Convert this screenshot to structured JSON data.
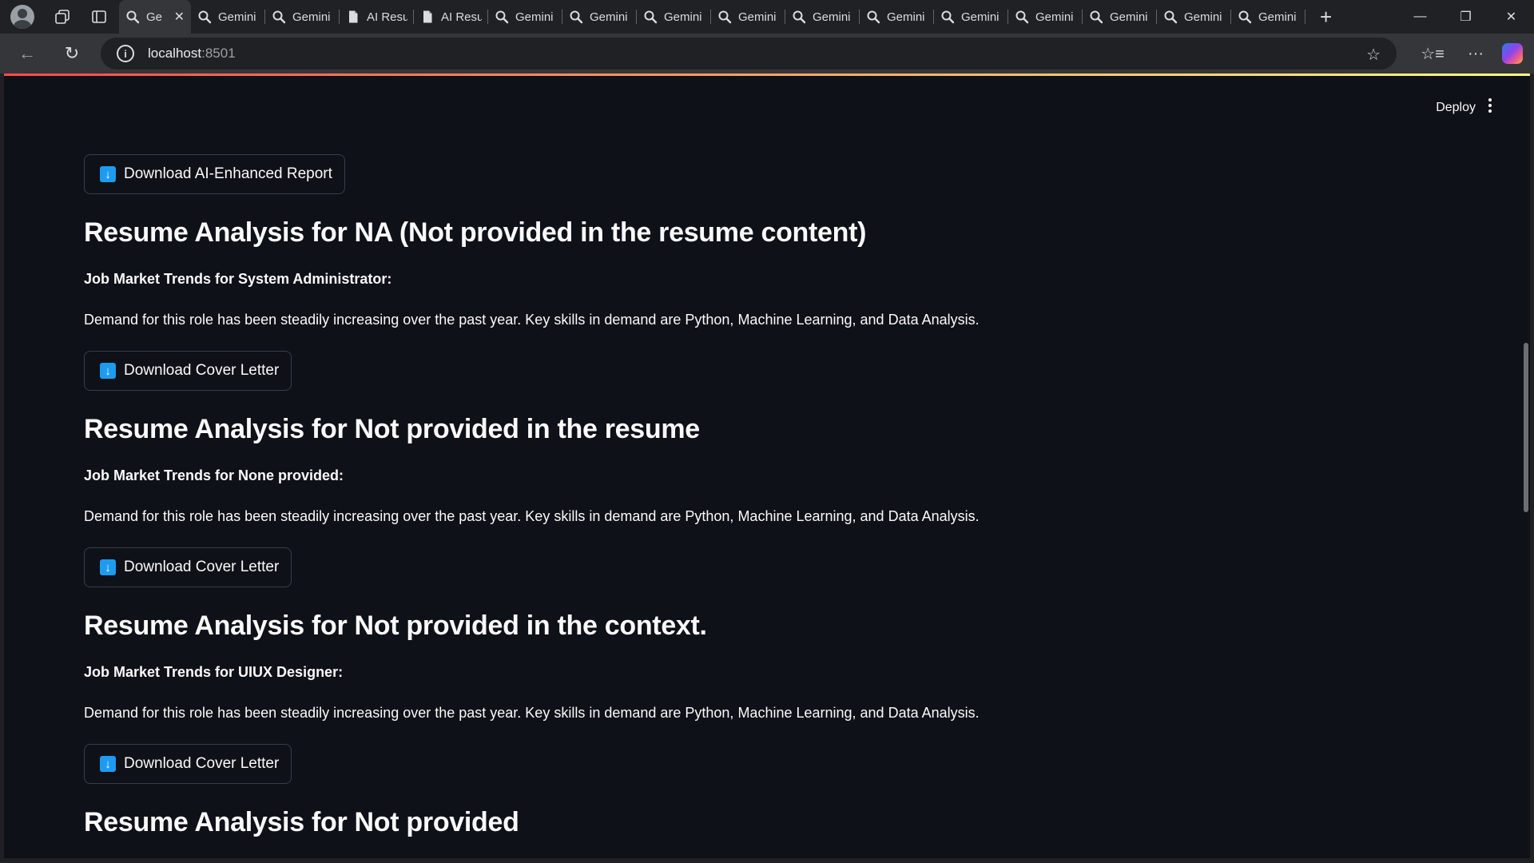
{
  "browser": {
    "tabs": [
      {
        "title": "Ge",
        "icon": "search-icon",
        "active": true
      },
      {
        "title": "Gemini",
        "icon": "search-icon"
      },
      {
        "title": "Gemini",
        "icon": "search-icon"
      },
      {
        "title": "AI Resu",
        "icon": "document-icon"
      },
      {
        "title": "AI Resu",
        "icon": "document-icon"
      },
      {
        "title": "Gemini",
        "icon": "search-icon"
      },
      {
        "title": "Gemini",
        "icon": "search-icon"
      },
      {
        "title": "Gemini",
        "icon": "search-icon"
      },
      {
        "title": "Gemini",
        "icon": "search-icon"
      },
      {
        "title": "Gemini",
        "icon": "search-icon"
      },
      {
        "title": "Gemini",
        "icon": "search-icon"
      },
      {
        "title": "Gemini",
        "icon": "search-icon"
      },
      {
        "title": "Gemini",
        "icon": "search-icon"
      },
      {
        "title": "Gemini",
        "icon": "search-icon"
      },
      {
        "title": "Gemini",
        "icon": "search-icon"
      },
      {
        "title": "Gemini",
        "icon": "search-icon"
      }
    ],
    "address": {
      "host": "localhost",
      "port": ":8501"
    }
  },
  "app": {
    "header": {
      "deploy_label": "Deploy"
    },
    "download_report_label": "Download AI-Enhanced Report",
    "sections": [
      {
        "heading": "Resume Analysis for NA (Not provided in the resume content)",
        "trends_label": "Job Market Trends for System Administrator:",
        "trends_text": "Demand for this role has been steadily increasing over the past year. Key skills in demand are Python, Machine Learning, and Data Analysis.",
        "button_label": "Download Cover Letter"
      },
      {
        "heading": "Resume Analysis for Not provided in the resume",
        "trends_label": "Job Market Trends for None provided:",
        "trends_text": "Demand for this role has been steadily increasing over the past year. Key skills in demand are Python, Machine Learning, and Data Analysis.",
        "button_label": "Download Cover Letter"
      },
      {
        "heading": "Resume Analysis for Not provided in the context.",
        "trends_label": "Job Market Trends for UIUX Designer:",
        "trends_text": "Demand for this role has been steadily increasing over the past year. Key skills in demand are Python, Machine Learning, and Data Analysis.",
        "button_label": "Download Cover Letter"
      },
      {
        "heading": "Resume Analysis for Not provided"
      }
    ]
  },
  "colors": {
    "app_background": "#0e1117",
    "download_icon": "#1d9bf0",
    "browser_chrome": "#202124"
  }
}
